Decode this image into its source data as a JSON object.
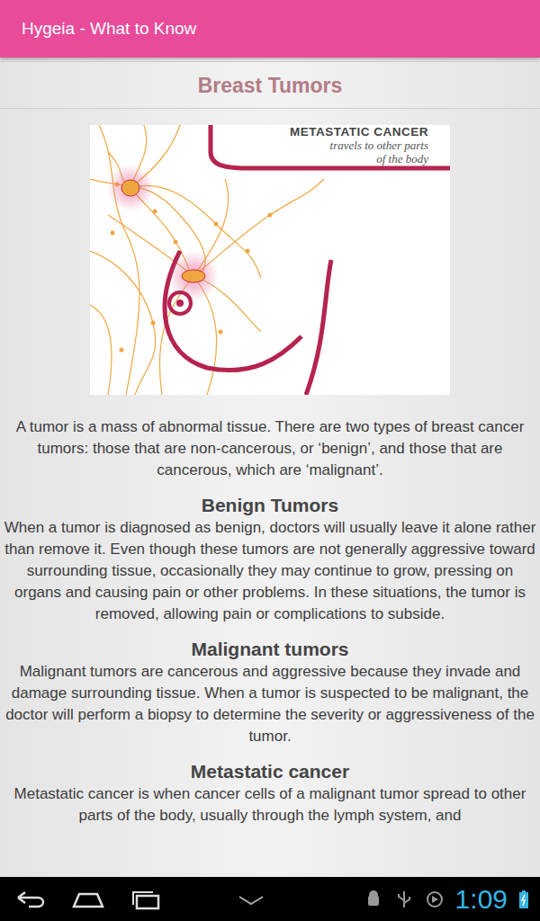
{
  "app_bar": {
    "title": "Hygeia - What to Know"
  },
  "page": {
    "title": "Breast Tumors"
  },
  "figure": {
    "title": "METASTATIC CANCER",
    "caption_lines": [
      "travels to other parts",
      "of the body"
    ]
  },
  "intro": "A tumor is a mass of abnormal tissue. There are two types of breast cancer tumors: those that are non-cancerous, or ‘benign’, and those that are cancerous, which are ‘malignant’.",
  "sections": [
    {
      "heading": "Benign Tumors",
      "body": "When a tumor is diagnosed as benign, doctors will usually leave it alone rather than remove it. Even though these tumors are not generally aggressive toward surrounding tissue, occasionally they may continue to grow, pressing on organs and causing pain or other problems. In these situations, the tumor is removed, allowing pain or complications to subside."
    },
    {
      "heading": "Malignant tumors",
      "body": "Malignant tumors are cancerous and aggressive because they invade and damage surrounding tissue. When a tumor is suspected to be malignant, the doctor will perform a biopsy to determine the severity or aggressiveness of the tumor."
    },
    {
      "heading": "Metastatic cancer",
      "body": "Metastatic cancer is when cancer cells of a malignant tumor spread to other parts of the body, usually through the lymph system, and"
    }
  ],
  "nav_bar": {
    "time": "1:09"
  }
}
